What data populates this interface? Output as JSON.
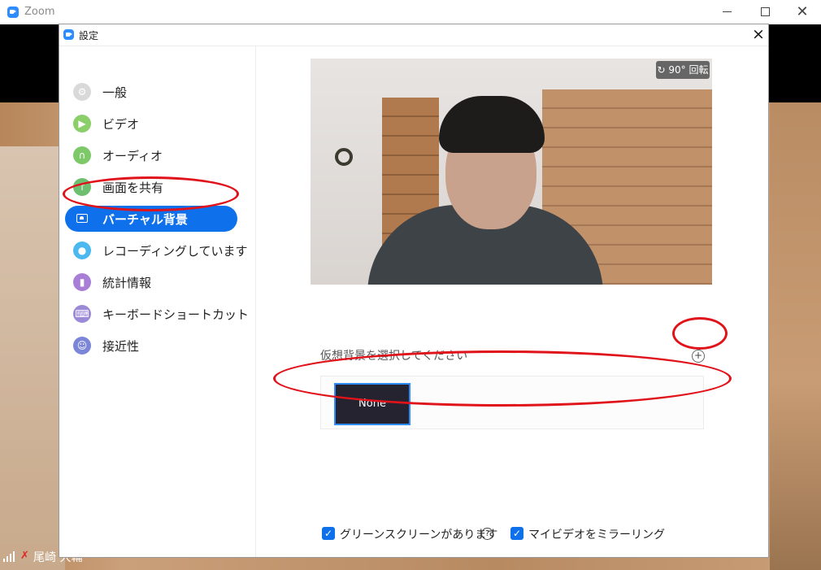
{
  "main_window": {
    "title": "Zoom",
    "participant_name": "尾崎 大輔"
  },
  "settings": {
    "title": "設定",
    "close_label": "×",
    "sidebar": {
      "items": [
        {
          "label": "一般",
          "icon": "gear-icon",
          "color": "#d9d9d9"
        },
        {
          "label": "ビデオ",
          "icon": "video-camera-icon",
          "color": "#8bcf6a"
        },
        {
          "label": "オーディオ",
          "icon": "headphones-icon",
          "color": "#7dc96a"
        },
        {
          "label": "画面を共有",
          "icon": "share-screen-icon",
          "color": "#6fbf71"
        },
        {
          "label": "バーチャル背景",
          "icon": "virtual-background-icon",
          "color": "#0e71eb",
          "active": true
        },
        {
          "label": "レコーディングしています",
          "icon": "record-icon",
          "color": "#4cb8f0"
        },
        {
          "label": "統計情報",
          "icon": "statistics-icon",
          "color": "#a97ed6"
        },
        {
          "label": "キーボードショートカット",
          "icon": "keyboard-icon",
          "color": "#9a8ad8"
        },
        {
          "label": "接近性",
          "icon": "accessibility-icon",
          "color": "#7c86d8"
        }
      ]
    },
    "virtual_background": {
      "rotate_label": "90° 回転",
      "choose_label": "仮想背景を選択してください",
      "add_label": "+",
      "backgrounds": [
        {
          "label": "None",
          "selected": true
        }
      ],
      "green_screen_label": "グリーンスクリーンがあります",
      "green_screen_checked": true,
      "help_label": "?",
      "mirror_label": "マイビデオをミラーリング",
      "mirror_checked": true
    }
  },
  "colors": {
    "accent": "#0e71eb",
    "annotation": "#e0131b"
  }
}
